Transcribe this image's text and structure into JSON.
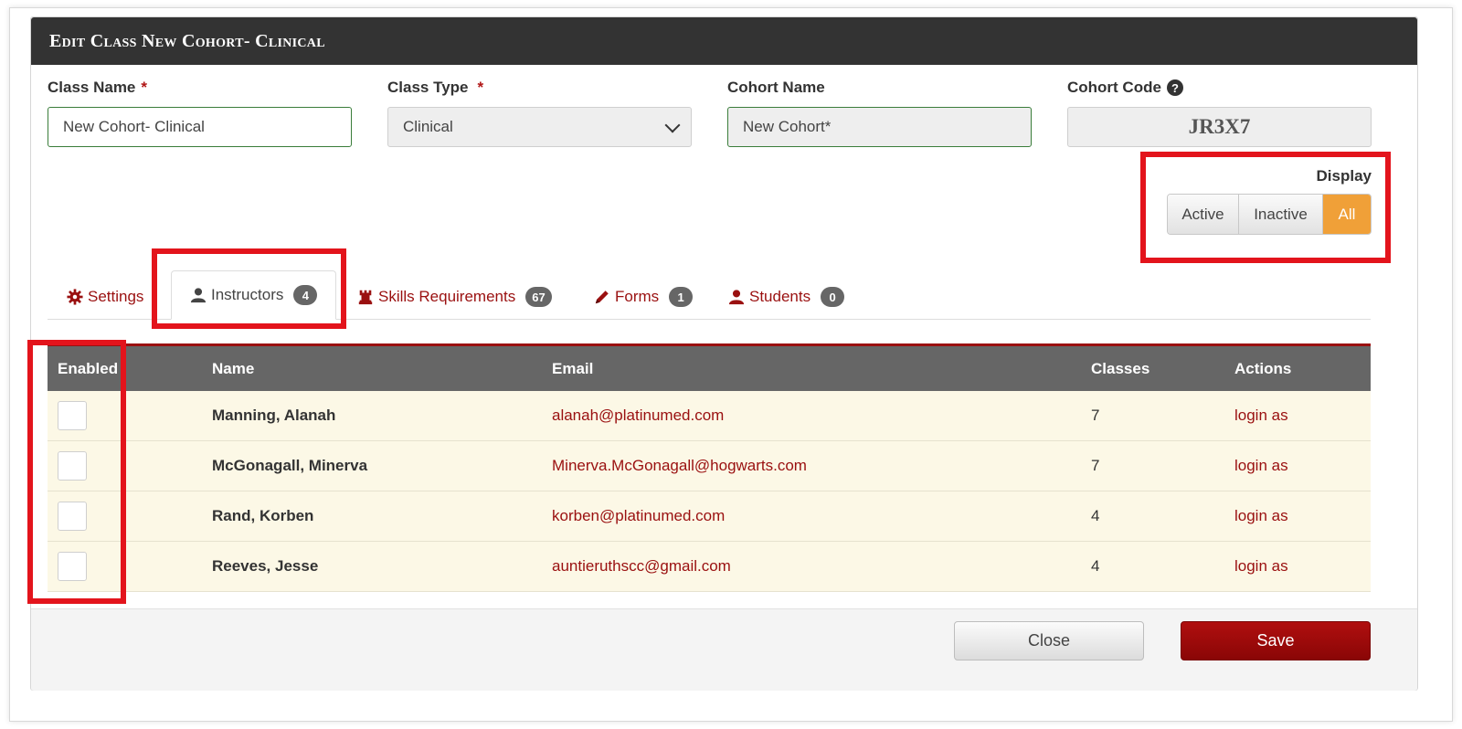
{
  "modal": {
    "title": "Edit Class New Cohort- Clinical"
  },
  "form": {
    "class_name": {
      "label": "Class Name",
      "required": "*",
      "value": "New Cohort- Clinical"
    },
    "class_type": {
      "label": "Class Type",
      "required": "*",
      "value": "Clinical"
    },
    "cohort_name": {
      "label": "Cohort Name",
      "value": "New Cohort*"
    },
    "cohort_code": {
      "label": "Cohort Code",
      "help_glyph": "?",
      "value": "JR3X7"
    }
  },
  "display": {
    "label": "Display",
    "options": [
      "Active",
      "Inactive",
      "All"
    ],
    "selected": "All"
  },
  "tabs": [
    {
      "label": "Settings",
      "icon": "gear-icon",
      "badge": ""
    },
    {
      "label": "Instructors",
      "icon": "user-icon",
      "badge": "4"
    },
    {
      "label": "Skills Requirements",
      "icon": "rook-icon",
      "badge": "67"
    },
    {
      "label": "Forms",
      "icon": "pencil-icon",
      "badge": "1"
    },
    {
      "label": "Students",
      "icon": "user-icon",
      "badge": "0"
    }
  ],
  "active_tab": "Instructors",
  "table": {
    "headers": [
      "Enabled",
      "Name",
      "Email",
      "Classes",
      "Actions"
    ],
    "rows": [
      {
        "name": "Manning, Alanah",
        "email": "alanah@platinumed.com",
        "classes": "7",
        "action": "login as"
      },
      {
        "name": "McGonagall, Minerva",
        "email": "Minerva.McGonagall@hogwarts.com",
        "classes": "7",
        "action": "login as"
      },
      {
        "name": "Rand, Korben",
        "email": "korben@platinumed.com",
        "classes": "4",
        "action": "login as"
      },
      {
        "name": "Reeves, Jesse",
        "email": "auntieruthscc@gmail.com",
        "classes": "4",
        "action": "login as"
      }
    ]
  },
  "footer": {
    "close_label": "Close",
    "save_label": "Save"
  },
  "colors": {
    "header_bg": "#333333",
    "accent_red": "#9a1010",
    "selected_orange": "#f0a038",
    "annotation_red": "#e3141c",
    "row_bg": "#fcf8e6"
  }
}
